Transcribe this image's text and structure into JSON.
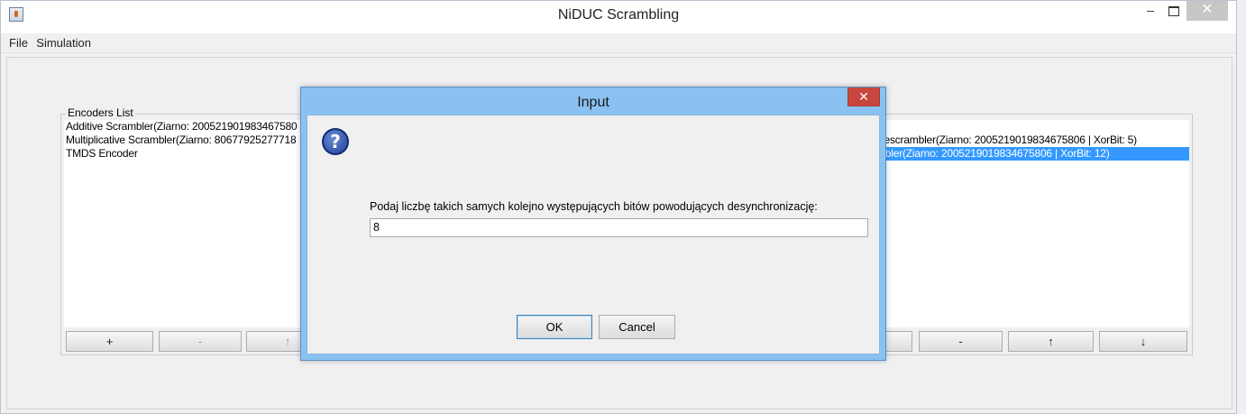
{
  "window": {
    "title": "NiDUC Scrambling",
    "controls": {
      "minimize": "–",
      "close": "✕"
    }
  },
  "menu": {
    "items": [
      "File",
      "Simulation"
    ]
  },
  "left_panel": {
    "title": "Encoders List",
    "items": [
      "Additive Scrambler(Ziarno: 200521901983467580",
      "Multiplicative Scrambler(Ziarno: 80677925277718",
      "TMDS Encoder"
    ],
    "buttons": [
      "+",
      "-",
      "↑"
    ]
  },
  "right_panel": {
    "items": [
      "Descrambler(Ziarno: 2005219019834675806 | XorBit: 5)",
      "mbler(Ziarno: 2005219019834675806 | XorBit: 12)"
    ],
    "selected_index": 1,
    "buttons": [
      "-",
      "↑",
      "↓"
    ]
  },
  "dialog": {
    "title": "Input",
    "close": "✕",
    "icon": "?",
    "prompt": "Podaj liczbę takich samych kolejno występujących bitów powodujących desynchronizację:",
    "value": "8",
    "ok_label": "OK",
    "cancel_label": "Cancel"
  },
  "colors": {
    "dialog_frame": "#89c1f1",
    "close_red": "#c7463d",
    "selection": "#3399ff"
  }
}
